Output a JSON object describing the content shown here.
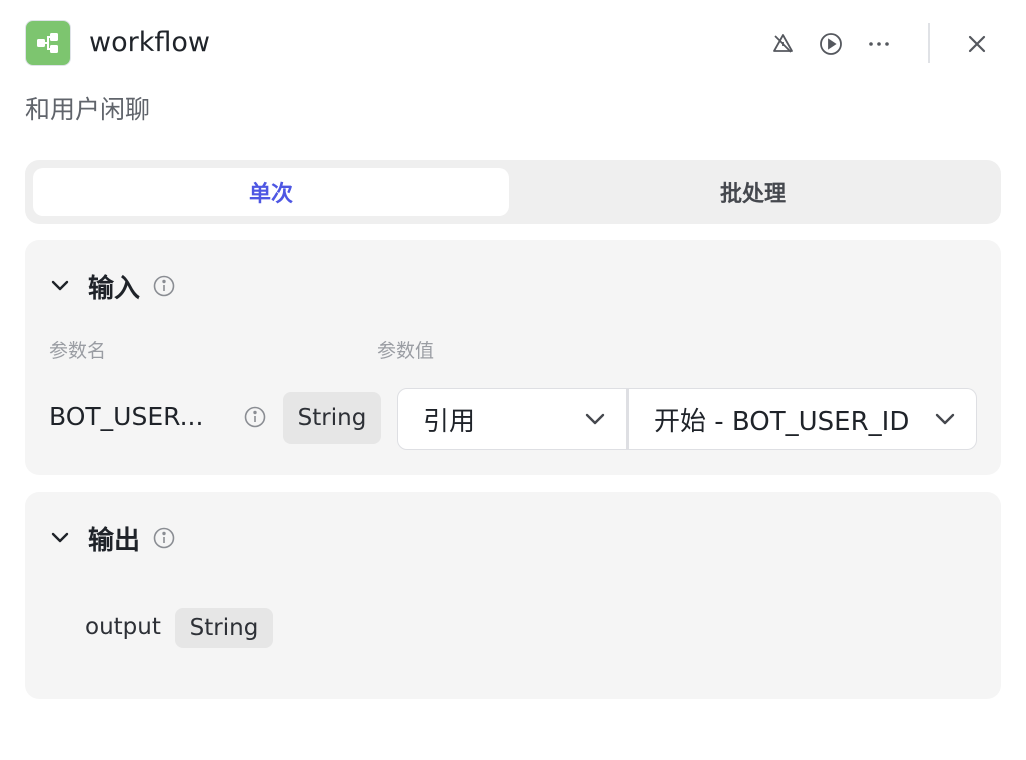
{
  "header": {
    "title": "workflow",
    "description": "和用户闲聊",
    "icons": {
      "app": "workflow-node-icon",
      "alert": "alert-off-icon",
      "run": "play-circle-icon",
      "more": "more-dots-icon",
      "close": "close-icon"
    },
    "accent": "#7dc56f"
  },
  "tabs": [
    {
      "label": "单次",
      "active": true
    },
    {
      "label": "批处理",
      "active": false
    }
  ],
  "input": {
    "title": "输入",
    "columns": {
      "name": "参数名",
      "value": "参数值"
    },
    "params": [
      {
        "name": "BOT_USER...",
        "type": "String",
        "source": "引用",
        "value": "开始 - BOT_USER_ID"
      }
    ]
  },
  "output": {
    "title": "输出",
    "fields": [
      {
        "name": "output",
        "type": "String"
      }
    ]
  },
  "colors": {
    "active_tab_text": "#4e57e3",
    "card_bg": "#f5f5f5",
    "tab_bg": "#efefef"
  }
}
